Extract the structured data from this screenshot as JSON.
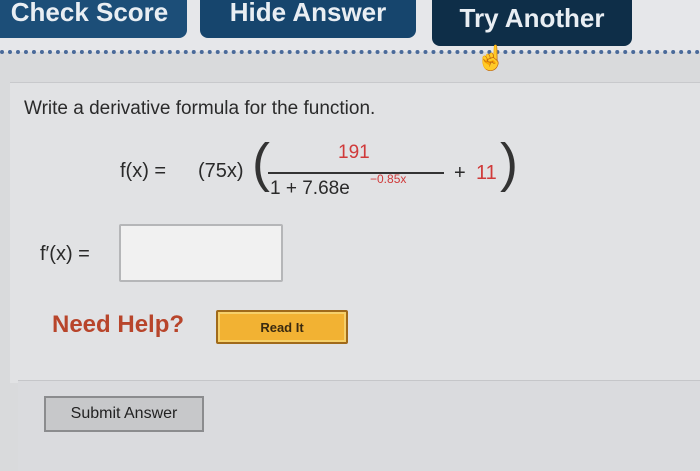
{
  "toolbar": {
    "check_score": "Check Score",
    "hide_answer": "Hide Answer",
    "try_another": "Try Another"
  },
  "question": {
    "prompt": "Write a derivative formula for the function.",
    "lhs": "f(x) =",
    "coef": "(75x)",
    "numerator": "191",
    "denominator_base": "1 + 7.68e",
    "exponent": "−0.85x",
    "plus": "+",
    "constant": "11",
    "answer_label": "f′(x) =",
    "answer_value": ""
  },
  "help": {
    "label": "Need Help?",
    "read_it": "Read It"
  },
  "actions": {
    "submit": "Submit Answer"
  }
}
